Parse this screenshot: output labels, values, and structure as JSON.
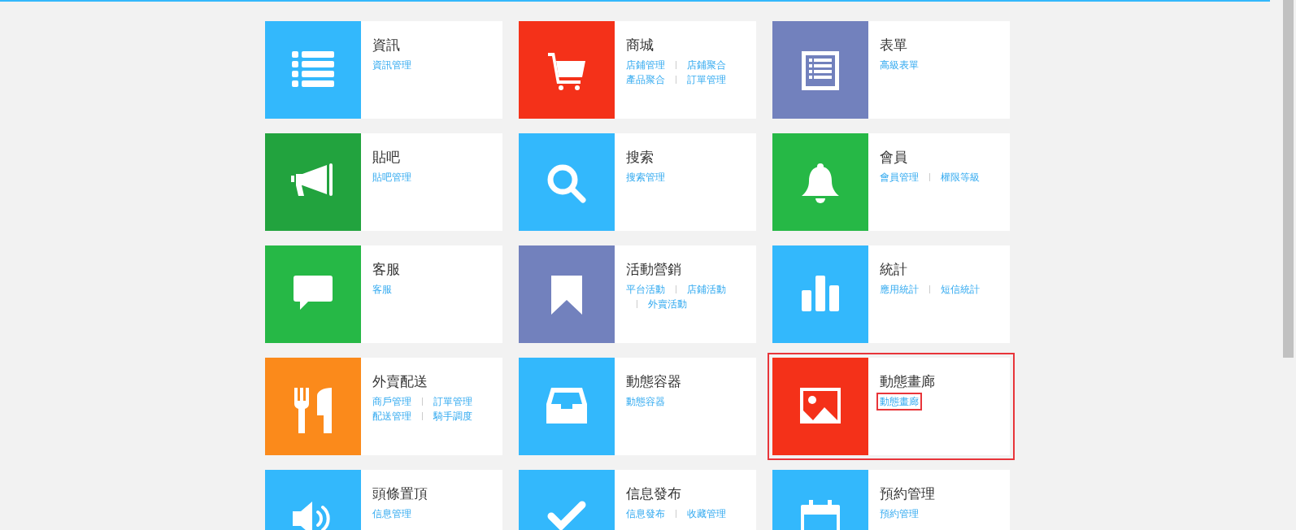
{
  "cards": [
    {
      "title": "資訊",
      "color": "#33b8fc",
      "highlighted": false,
      "links": [
        {
          "label": "資訊管理",
          "highlighted": false
        }
      ]
    },
    {
      "title": "商城",
      "color": "#f43119",
      "highlighted": false,
      "links": [
        {
          "label": "店鋪管理",
          "highlighted": false
        },
        {
          "label": "店鋪聚合",
          "highlighted": false
        },
        {
          "label": "產品聚合",
          "highlighted": false
        },
        {
          "label": "訂單管理",
          "highlighted": false
        }
      ]
    },
    {
      "title": "表單",
      "color": "#7281bd",
      "highlighted": false,
      "links": [
        {
          "label": "高級表單",
          "highlighted": false
        }
      ]
    },
    {
      "title": "貼吧",
      "color": "#22a33e",
      "highlighted": false,
      "links": [
        {
          "label": "貼吧管理",
          "highlighted": false
        }
      ]
    },
    {
      "title": "搜索",
      "color": "#33b8fc",
      "highlighted": false,
      "links": [
        {
          "label": "搜索管理",
          "highlighted": false
        }
      ]
    },
    {
      "title": "會員",
      "color": "#26b846",
      "highlighted": false,
      "links": [
        {
          "label": "會員管理",
          "highlighted": false
        },
        {
          "label": "權限等級",
          "highlighted": false
        }
      ]
    },
    {
      "title": "客服",
      "color": "#26b846",
      "highlighted": false,
      "links": [
        {
          "label": "客服",
          "highlighted": false
        }
      ]
    },
    {
      "title": "活動營銷",
      "color": "#7281bd",
      "highlighted": false,
      "links": [
        {
          "label": "平台活動",
          "highlighted": false
        },
        {
          "label": "店鋪活動",
          "highlighted": false
        },
        {
          "label": "外賣活動",
          "highlighted": false
        }
      ]
    },
    {
      "title": "統計",
      "color": "#33b8fc",
      "highlighted": false,
      "links": [
        {
          "label": "應用統計",
          "highlighted": false
        },
        {
          "label": "短信統計",
          "highlighted": false
        }
      ]
    },
    {
      "title": "外賣配送",
      "color": "#fb8a1b",
      "highlighted": false,
      "links": [
        {
          "label": "商戶管理",
          "highlighted": false
        },
        {
          "label": "訂單管理",
          "highlighted": false
        },
        {
          "label": "配送管理",
          "highlighted": false
        },
        {
          "label": "騎手調度",
          "highlighted": false
        }
      ]
    },
    {
      "title": "動態容器",
      "color": "#33b8fc",
      "highlighted": false,
      "links": [
        {
          "label": "動態容器",
          "highlighted": false
        }
      ]
    },
    {
      "title": "動態畫廊",
      "color": "#f43119",
      "highlighted": true,
      "links": [
        {
          "label": "動態畫廊",
          "highlighted": true
        }
      ]
    },
    {
      "title": "頭條置頂",
      "color": "#33b8fc",
      "highlighted": false,
      "links": [
        {
          "label": "信息管理",
          "highlighted": false
        }
      ]
    },
    {
      "title": "信息發布",
      "color": "#33b8fc",
      "highlighted": false,
      "links": [
        {
          "label": "信息發布",
          "highlighted": false
        },
        {
          "label": "收藏管理",
          "highlighted": false
        }
      ]
    },
    {
      "title": "預約管理",
      "color": "#33b8fc",
      "highlighted": false,
      "links": [
        {
          "label": "預約管理",
          "highlighted": false
        }
      ]
    }
  ]
}
